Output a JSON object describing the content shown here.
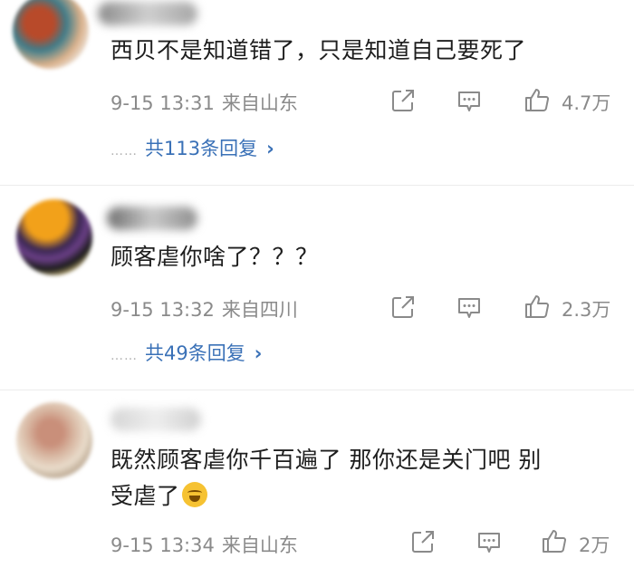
{
  "comments": [
    {
      "text": "西贝不是知道错了，只是知道自己要死了",
      "time": "9-15 13:31",
      "location": "来自山东",
      "likes": "4.7万",
      "replies": "共113条回复",
      "dots": "……"
    },
    {
      "text": "顾客虐你啥了？？？",
      "time": "9-15 13:32",
      "location": "来自四川",
      "likes": "2.3万",
      "replies": "共49条回复",
      "dots": "……"
    },
    {
      "text_line1": "既然顾客虐你千百遍了 那你还是关门吧 别",
      "text_line2": "受虐了",
      "time": "9-15 13:34",
      "location": "来自山东",
      "likes": "2万"
    }
  ],
  "icons": {
    "share": "share-icon",
    "reply": "comment-icon",
    "like": "thumbs-up-icon",
    "emoji": "laugh-cry-emoji"
  },
  "colors": {
    "link": "#3a71b7",
    "meta": "#8a8a8a"
  }
}
